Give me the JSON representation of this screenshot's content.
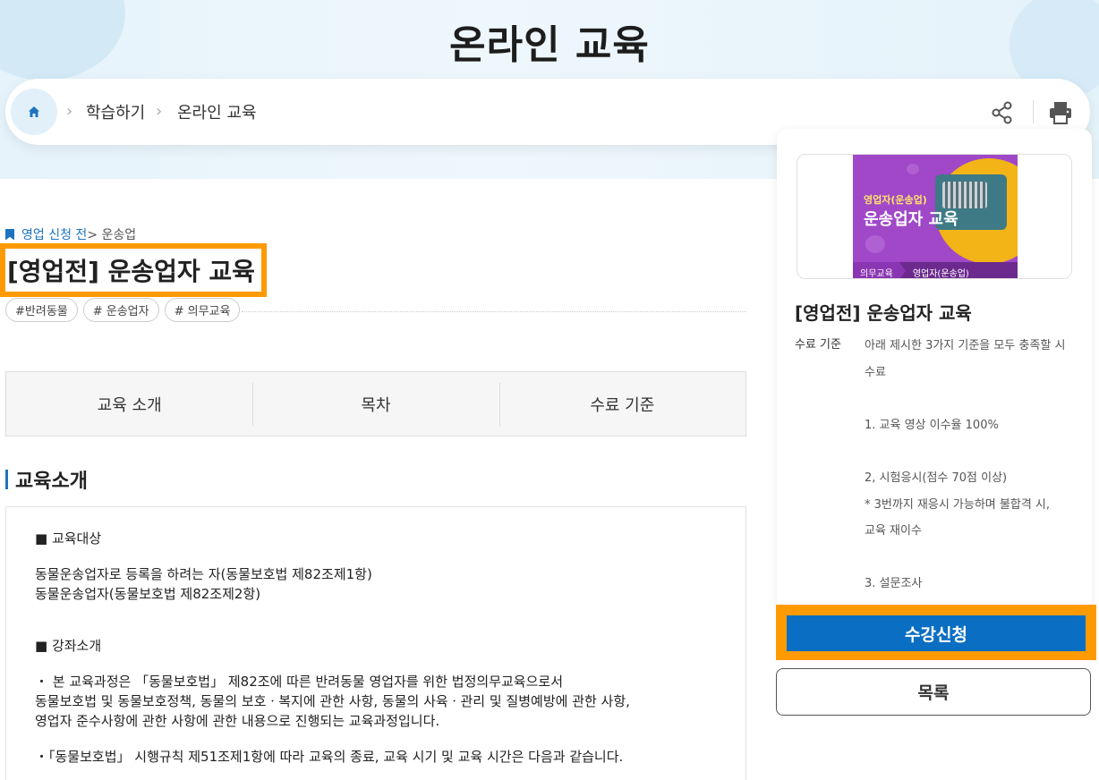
{
  "header": {
    "title": "온라인 교육"
  },
  "breadcrumb": {
    "items": [
      "학습하기",
      "온라인 교육"
    ]
  },
  "course": {
    "category_link": "영업 신청 전",
    "category_rest": "> 운송업",
    "title": "[영업전] 운송업자 교육",
    "tags": [
      "#반려동물",
      "# 운송업자",
      "# 의무교육"
    ]
  },
  "tabs": [
    "교육 소개",
    "목차",
    "수료 기준"
  ],
  "intro": {
    "heading": "교육소개",
    "target_heading": "■ 교육대상",
    "target_lines": [
      "동물운송업자로 등록을 하려는 자(동물보호법 제82조제1항)",
      "동물운송업자(동물보호법 제82조제2항)"
    ],
    "lecture_heading": "■ 강좌소개",
    "lecture_lines": [
      "・ 본 교육과정은 「동물보호법」 제82조에 따른 반려동물 영업자를 위한 법정의무교육으로서",
      "동물보호법 및 동물보호정책, 동물의 보호ㆍ복지에 관한 사항, 동물의 사육ㆍ관리 및 질병예방에 관한 사항,",
      "영업자 준수사항에 관한 사항에 관한 내용으로 진행되는 교육과정입니다."
    ],
    "rule_line": "・「동물보호법」 시행규칙 제51조제1항에 따라 교육의 종료, 교육 시기 및 교육 시간은 다음과 같습니다."
  },
  "side": {
    "thumb_small": "영업자(운송업)",
    "thumb_big": "운송업자 교육",
    "thumb_tag1": "의무교육",
    "thumb_tag2": "영업자(운송업)",
    "title": "[영업전] 운송업자 교육",
    "criteria_label": "수료 기준",
    "criteria_lines": [
      "아래 제시한 3가지 기준을 모두 충족할 시",
      "수료",
      "",
      "1. 교육 영상 이수율 100%",
      "",
      "2, 시험응시(점수 70점 이상)",
      "* 3번까지 재응시 가능하며 불합격 시,",
      "교육 재이수",
      "",
      "3. 설문조사"
    ],
    "apply_label": "수강신청",
    "list_label": "목록"
  },
  "colors": {
    "accent_blue": "#1e73be",
    "apply_blue": "#0a6fc2",
    "highlight_orange": "#ff9a00"
  }
}
